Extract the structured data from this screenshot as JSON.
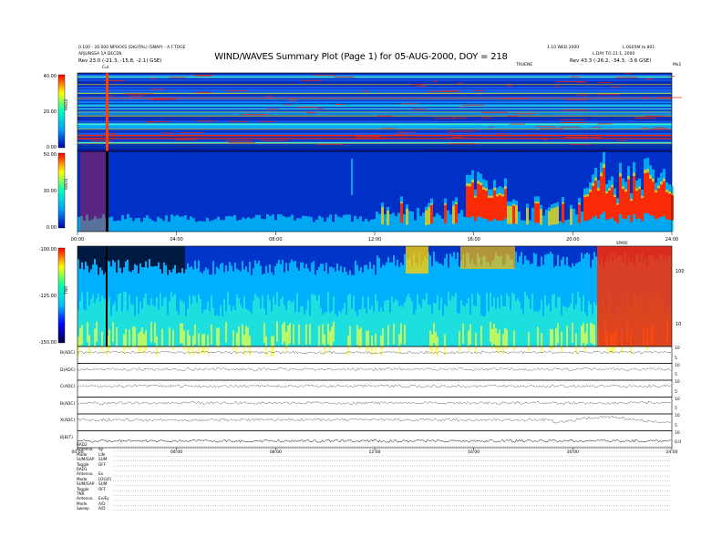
{
  "header": {
    "title": "WIND/WAVES Summary Plot (Page 1) for 05-AUG-2000, DOY = 218",
    "left_line1": "0.100 - 20.000 NPOCKS (DIGITAL) (SNAP) - A.F.TOGE",
    "left_line2": "ARJUNSSA 1A DECEN",
    "left_rev": "Rev      23.0 (-21.3, -15.8, -2.1) GSE)",
    "right_line1": "1.10 WED 2000",
    "right_line2": "L.DAY TO 21:1, 2000",
    "right_line3": "L.0S05M to 801",
    "right_rev": "Rev      43.3 (-26.2, -34.3, -3.6 GSE)",
    "sub_left_tag": "Cul",
    "sub_center_tag": "TRUENE",
    "sub_right_tag": "Mx1",
    "mark_label": "SPARE"
  },
  "panels": [
    {
      "label": "RAD2",
      "ticks": [
        "40.00",
        "20.00",
        "0.00"
      ]
    },
    {
      "label": "RAD1",
      "ticks": [
        "50.00",
        "30.00",
        "0.00"
      ]
    },
    {
      "label": "TNR",
      "ticks": [
        "-100.00",
        "-125.00",
        "-150.00"
      ],
      "right_ticks": [
        "100",
        "10"
      ]
    }
  ],
  "time_ticks_top": [
    "00:00",
    "04:00",
    "08:00",
    "12:00",
    "16:00",
    "20:00",
    "24:00"
  ],
  "time_ticks_bottom": [
    "00:00",
    "04:00",
    "08:00",
    "12:00",
    "16:00",
    "20:00",
    "24:00"
  ],
  "traces": [
    {
      "label": "B(ADC)",
      "right": [
        "10",
        "5"
      ]
    },
    {
      "label": "D(ADC)",
      "right": [
        "10",
        "5"
      ]
    },
    {
      "label": "C(ADC)",
      "right": [
        "10",
        "5"
      ]
    },
    {
      "label": "B(ADC)",
      "right": [
        "10",
        "5"
      ]
    },
    {
      "label": "X(ADC)",
      "right": [
        "10",
        "5"
      ]
    },
    {
      "label": "B|B(T)",
      "right": [
        "10",
        "0.0"
      ]
    }
  ],
  "footer": [
    {
      "label": "RAD2",
      "value": ""
    },
    {
      "label": "Antenna",
      "value": "Sy"
    },
    {
      "label": "Mode",
      "value": "LIN"
    },
    {
      "label": "SUM/GAP",
      "value": "SUM"
    },
    {
      "label": "Toggle",
      "value": "OFF"
    },
    {
      "label": "RAD1",
      "value": ""
    },
    {
      "label": "Antenna",
      "value": "Ex"
    },
    {
      "label": "Mode",
      "value": "LOG(F)"
    },
    {
      "label": "SUM/GAP",
      "value": "SUM"
    },
    {
      "label": "Toggle",
      "value": "OFF"
    },
    {
      "label": "TNR",
      "value": ""
    },
    {
      "label": "Antenna",
      "value": "Ex/Ey"
    },
    {
      "label": "Mode",
      "value": "A/D"
    },
    {
      "label": "Sweep",
      "value": "A/D"
    }
  ],
  "chart_data": [
    {
      "type": "heatmap",
      "title": "RAD2",
      "x_range": [
        "00:00",
        "24:00"
      ],
      "ylim": [
        0,
        40
      ],
      "yticks": [
        0,
        20,
        40
      ],
      "colors": [
        "#0000aa",
        "#00a0ff",
        "#00ffc0",
        "#ffff00",
        "#ff0000"
      ]
    },
    {
      "type": "heatmap",
      "title": "RAD1",
      "x_range": [
        "00:00",
        "24:00"
      ],
      "ylim": [
        0,
        50
      ],
      "yticks": [
        0,
        30,
        50
      ],
      "colors": [
        "#0000aa",
        "#00a0ff",
        "#00ffc0",
        "#ffff00",
        "#ff0000"
      ]
    },
    {
      "type": "heatmap",
      "title": "TNR",
      "x_range": [
        "00:00",
        "24:00"
      ],
      "ylim": [
        -150,
        -100
      ],
      "yticks": [
        -150,
        -125,
        -100
      ],
      "colors": [
        "#000044",
        "#0000ff",
        "#00c0ff",
        "#00ffb0",
        "#ffff00",
        "#ff0000"
      ]
    }
  ]
}
